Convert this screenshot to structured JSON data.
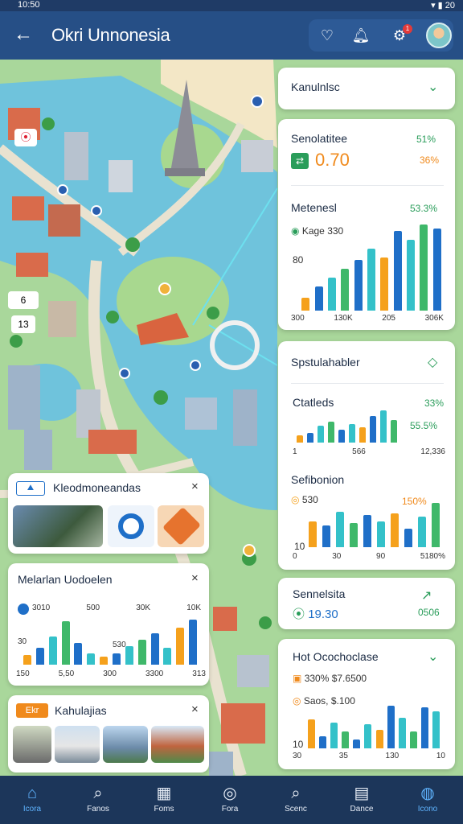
{
  "status": {
    "time": "10:50",
    "right": "▾ ▮ 20"
  },
  "header": {
    "title": "Okri Unnonesia",
    "badge": "1"
  },
  "map_labels": {
    "a": "6",
    "b": "13"
  },
  "right_cards": {
    "c1": {
      "title": "Kanulnlsc"
    },
    "c2": {
      "title": "Senolatitee",
      "pct1": "51%",
      "value": "0.70",
      "pct2": "36%",
      "sub_title": "Metenesl",
      "sub_pct": "53.3%",
      "legend": "Kage 330",
      "y_tick": "80",
      "x_ticks": [
        "300",
        "130K",
        "205",
        "306K"
      ],
      "values": [
        12,
        22,
        30,
        38,
        46,
        56,
        48,
        72,
        64,
        78,
        74
      ]
    },
    "c3": {
      "title": "Spstulahabler",
      "sub_title": "Ctatleds",
      "pct1": "33%",
      "pct2": "55.5%",
      "x_ticks": [
        "1",
        "566",
        "12,336"
      ],
      "values": [
        8,
        10,
        18,
        22,
        14,
        20,
        16,
        28,
        34,
        24
      ],
      "sub2_title": "Sefibonion",
      "sub2_legend": "530",
      "sub2_pct": "150%",
      "sub2_y": "10",
      "sub2_x": [
        "0",
        "30",
        "90",
        "5180%"
      ],
      "values2": [
        30,
        26,
        42,
        28,
        38,
        30,
        40,
        22,
        36,
        52
      ]
    },
    "c4": {
      "title": "Sennelsita",
      "value": "19.30",
      "right": "0506"
    },
    "c5": {
      "title": "Hot Ocochoclase",
      "line1": "330% $7.6500",
      "line2": "Saos, $.100",
      "y": "10",
      "x_ticks": [
        "30",
        "35",
        "130",
        "10"
      ],
      "values": [
        34,
        14,
        30,
        20,
        10,
        28,
        22,
        50,
        36,
        20,
        48,
        44
      ]
    }
  },
  "left_cards": {
    "l1": {
      "title": "Kleodmoneandas"
    },
    "l2": {
      "title": "Melarlan Uodoelen",
      "x_ticks": [
        "150",
        "5,50",
        "300",
        "3300",
        "313"
      ],
      "top": [
        "3010",
        "500",
        "30K",
        "10K"
      ],
      "y": [
        "30",
        "530"
      ],
      "values": [
        12,
        20,
        34,
        52,
        26,
        14,
        10,
        14,
        22,
        30,
        38,
        20,
        44,
        54
      ]
    },
    "l3": {
      "title": "Kahulajias",
      "tag": "Ekr"
    }
  },
  "nav": [
    {
      "label": "Icora",
      "icon": "home-icon"
    },
    {
      "label": "Fanos",
      "icon": "search-icon"
    },
    {
      "label": "Foms",
      "icon": "box-icon"
    },
    {
      "label": "Fora",
      "icon": "compass-icon"
    },
    {
      "label": "Scenc",
      "icon": "search-icon"
    },
    {
      "label": "Dance",
      "icon": "bag-icon"
    },
    {
      "label": "Icono",
      "icon": "globe-icon"
    }
  ],
  "colors": {
    "blue": "#1f6fc8",
    "teal": "#34c1c9",
    "orange": "#f5a11c",
    "green": "#3fb86a",
    "header": "#264f86"
  }
}
